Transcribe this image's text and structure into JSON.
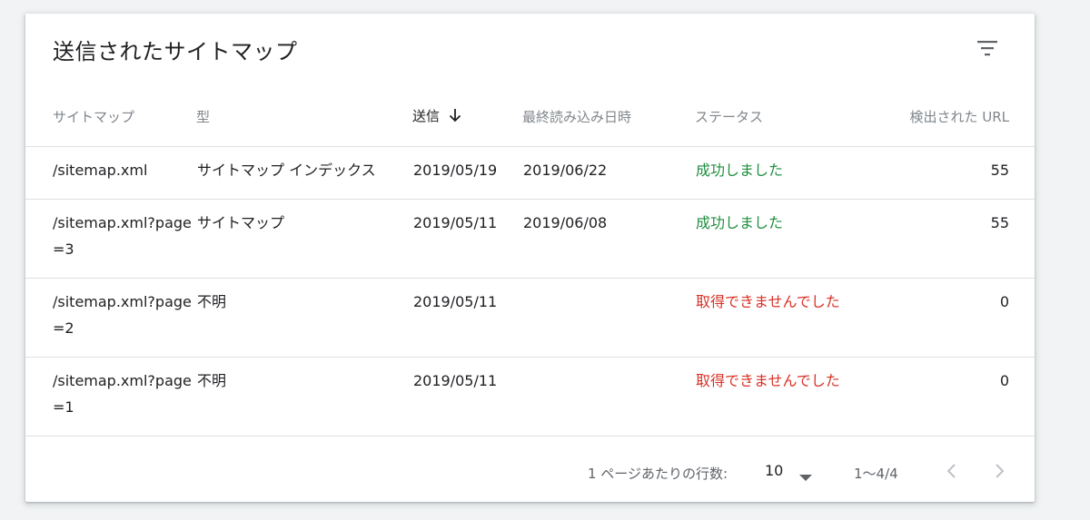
{
  "card": {
    "title": "送信されたサイトマップ",
    "filter_icon": "filter-list-icon"
  },
  "table": {
    "headers": {
      "sitemap": "サイトマップ",
      "type": "型",
      "submitted": "送信",
      "last_read": "最終読み込み日時",
      "status": "ステータス",
      "discovered_urls": "検出された URL"
    },
    "sort": {
      "column": "submitted",
      "direction": "descending",
      "icon": "arrow-down-icon"
    },
    "rows": [
      {
        "sitemap": "/sitemap.xml",
        "type": "サイトマップ インデックス",
        "submitted": "2019/05/19",
        "last_read": "2019/06/22",
        "status": "成功しました",
        "status_kind": "success",
        "urls": "55"
      },
      {
        "sitemap": "/sitemap.xml?page=3",
        "type": "サイトマップ",
        "submitted": "2019/05/11",
        "last_read": "2019/06/08",
        "status": "成功しました",
        "status_kind": "success",
        "urls": "55"
      },
      {
        "sitemap": "/sitemap.xml?page=2",
        "type": "不明",
        "submitted": "2019/05/11",
        "last_read": "",
        "status": "取得できませんでした",
        "status_kind": "error",
        "urls": "0"
      },
      {
        "sitemap": "/sitemap.xml?page=1",
        "type": "不明",
        "submitted": "2019/05/11",
        "last_read": "",
        "status": "取得できませんでした",
        "status_kind": "error",
        "urls": "0"
      }
    ]
  },
  "pagination": {
    "rows_per_page_label": "1 ページあたりの行数:",
    "rows_per_page_value": "10",
    "range": "1〜4/4",
    "prev_icon": "chevron-left-icon",
    "next_icon": "chevron-right-icon"
  },
  "colors": {
    "success": "#1e8e3e",
    "error": "#d93025",
    "text_primary": "#202124",
    "text_secondary": "#80868b"
  }
}
